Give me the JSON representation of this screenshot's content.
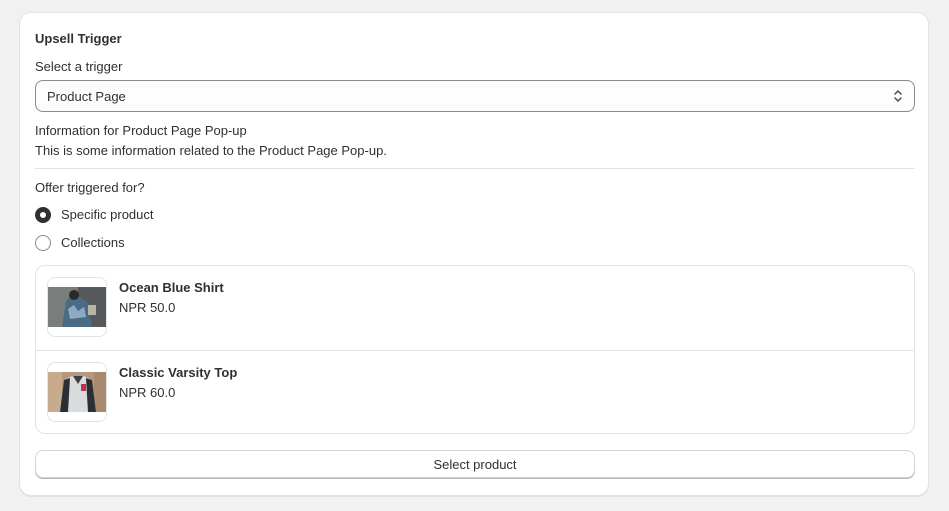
{
  "card": {
    "title": "Upsell Trigger"
  },
  "trigger": {
    "label": "Select a trigger",
    "selected": "Product Page",
    "info_title": "Information for Product Page Pop-up",
    "info_text": "This is some information related to the Product Page Pop-up."
  },
  "offer": {
    "label": "Offer triggered for?",
    "options": [
      {
        "label": "Specific product",
        "checked": true
      },
      {
        "label": "Collections",
        "checked": false
      }
    ]
  },
  "products": [
    {
      "name": "Ocean Blue Shirt",
      "price": "NPR 50.0",
      "image_icon": "shirt-photo"
    },
    {
      "name": "Classic Varsity Top",
      "price": "NPR 60.0",
      "image_icon": "varsity-top-photo"
    }
  ],
  "actions": {
    "select_product": "Select product"
  },
  "colors": {
    "text": "#303030",
    "border": "#e3e3e3",
    "background": "#f1f1f1",
    "card": "#ffffff"
  }
}
